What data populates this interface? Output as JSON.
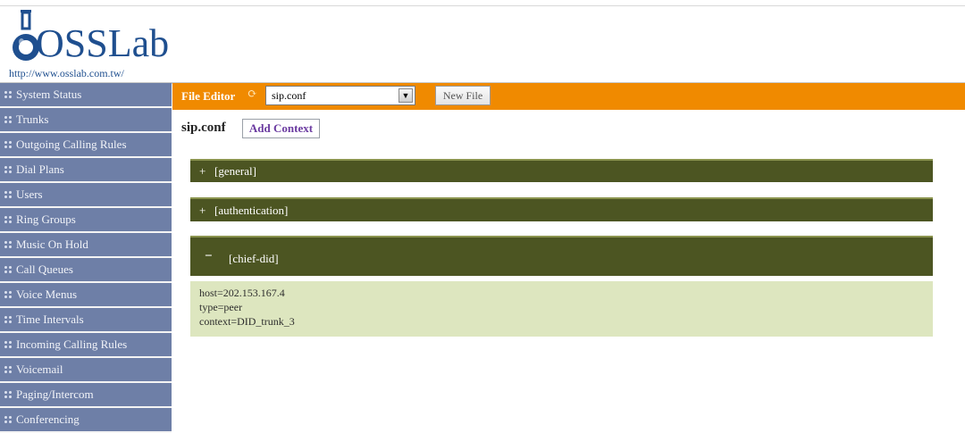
{
  "header": {
    "logo_text": "OSSLab",
    "logo_url": "http://www.osslab.com.tw/"
  },
  "sidebar": {
    "items": [
      {
        "label": "System Status"
      },
      {
        "label": "Trunks"
      },
      {
        "label": "Outgoing Calling Rules"
      },
      {
        "label": "Dial Plans"
      },
      {
        "label": "Users"
      },
      {
        "label": "Ring Groups"
      },
      {
        "label": "Music On Hold"
      },
      {
        "label": "Call Queues"
      },
      {
        "label": "Voice Menus"
      },
      {
        "label": "Time Intervals"
      },
      {
        "label": "Incoming Calling Rules"
      },
      {
        "label": "Voicemail"
      },
      {
        "label": "Paging/Intercom"
      },
      {
        "label": "Conferencing"
      }
    ]
  },
  "toolbar": {
    "title": "File Editor",
    "refresh_icon": "refresh-icon",
    "selected_file": "sip.conf",
    "new_file_label": "New File"
  },
  "editor": {
    "file_title": "sip.conf",
    "add_context_label": "Add Context",
    "contexts": [
      {
        "toggle": "+",
        "name": "[general]",
        "expanded": false
      },
      {
        "toggle": "+",
        "name": "[authentication]",
        "expanded": false
      },
      {
        "toggle": "−",
        "name": "[chief-did]",
        "expanded": true
      }
    ],
    "expanded_lines": [
      "host=202.153.167.4",
      "type=peer",
      "context=DID_trunk_3"
    ]
  },
  "colors": {
    "sidebar_bg": "#6e7fa7",
    "toolbar_bg": "#f08a00",
    "context_bar_bg": "#4c5522",
    "context_body_bg": "#dde6bf",
    "logo_blue": "#1f4f8f"
  }
}
